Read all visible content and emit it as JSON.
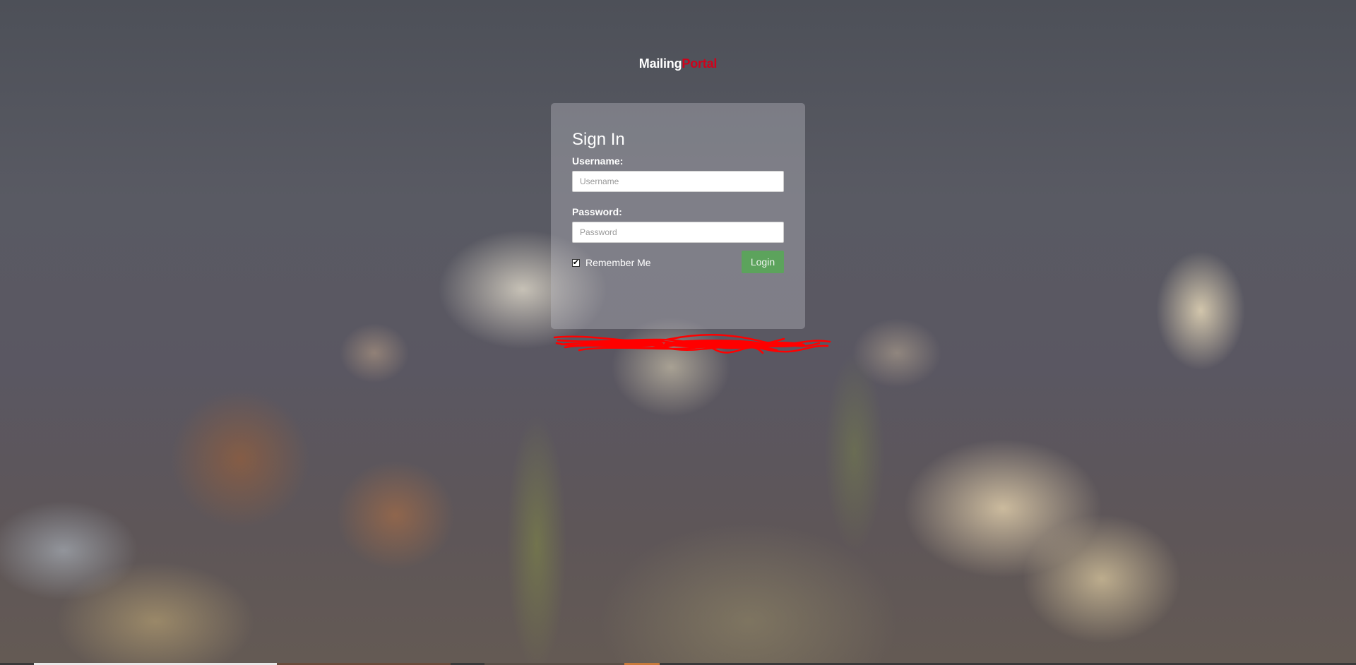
{
  "brand": {
    "part1": "Mailing",
    "part2": "Portal"
  },
  "login_form": {
    "title": "Sign In",
    "username_label": "Username:",
    "username_placeholder": "Username",
    "password_label": "Password:",
    "password_placeholder": "Password",
    "remember_label": "Remember Me",
    "remember_checked": true,
    "login_button": "Login"
  },
  "colors": {
    "brand_accent": "#d0021b",
    "login_button": "#5ca35c"
  },
  "icons": {
    "checkbox": "checkbox-checked-icon"
  }
}
